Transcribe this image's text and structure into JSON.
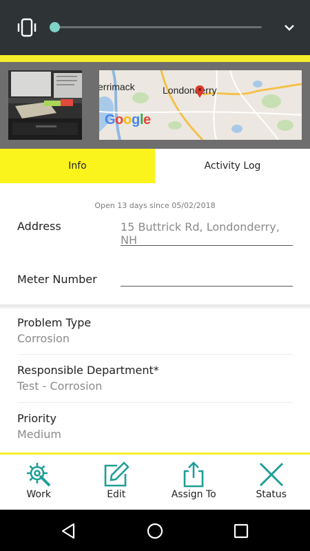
{
  "header": {
    "icon": "vibrate-icon",
    "slider_value": 0,
    "expand_icon": "chevron-down-icon",
    "accent_color": "#f6ee2a"
  },
  "media": {
    "photo_icon": "photo-thumbnail",
    "map": {
      "labels": [
        "errimack",
        "Londonderry"
      ],
      "logo_letters": [
        "G",
        "o",
        "o",
        "g",
        "l",
        "e"
      ]
    }
  },
  "tabs": [
    {
      "label": "Info",
      "active": true
    },
    {
      "label": "Activity Log",
      "active": false
    }
  ],
  "info": {
    "open_note": "Open 13 days since 05/02/2018",
    "address_label": "Address",
    "address_line1": "15 Buttrick Rd, Londonderry,",
    "address_line2": "NH",
    "meter_label": "Meter Number",
    "meter_value": ""
  },
  "details": [
    {
      "label": "Problem Type",
      "value": "Corrosion"
    },
    {
      "label": "Responsible Department*",
      "value": "Test - Corrosion"
    },
    {
      "label": "Priority",
      "value": "Medium"
    }
  ],
  "actions": [
    {
      "label": "Work",
      "icon": "gear-wrench-icon"
    },
    {
      "label": "Edit",
      "icon": "edit-icon"
    },
    {
      "label": "Assign To",
      "icon": "share-icon"
    },
    {
      "label": "Status",
      "icon": "close-icon"
    }
  ],
  "navbar": {
    "back_icon": "back-triangle-icon",
    "home_icon": "home-circle-icon",
    "recents_icon": "recents-square-icon"
  },
  "colors": {
    "teal_icon": "#1e9e96",
    "slider_thumb": "#7ed3c6",
    "tab_active": "#fbf41c"
  }
}
